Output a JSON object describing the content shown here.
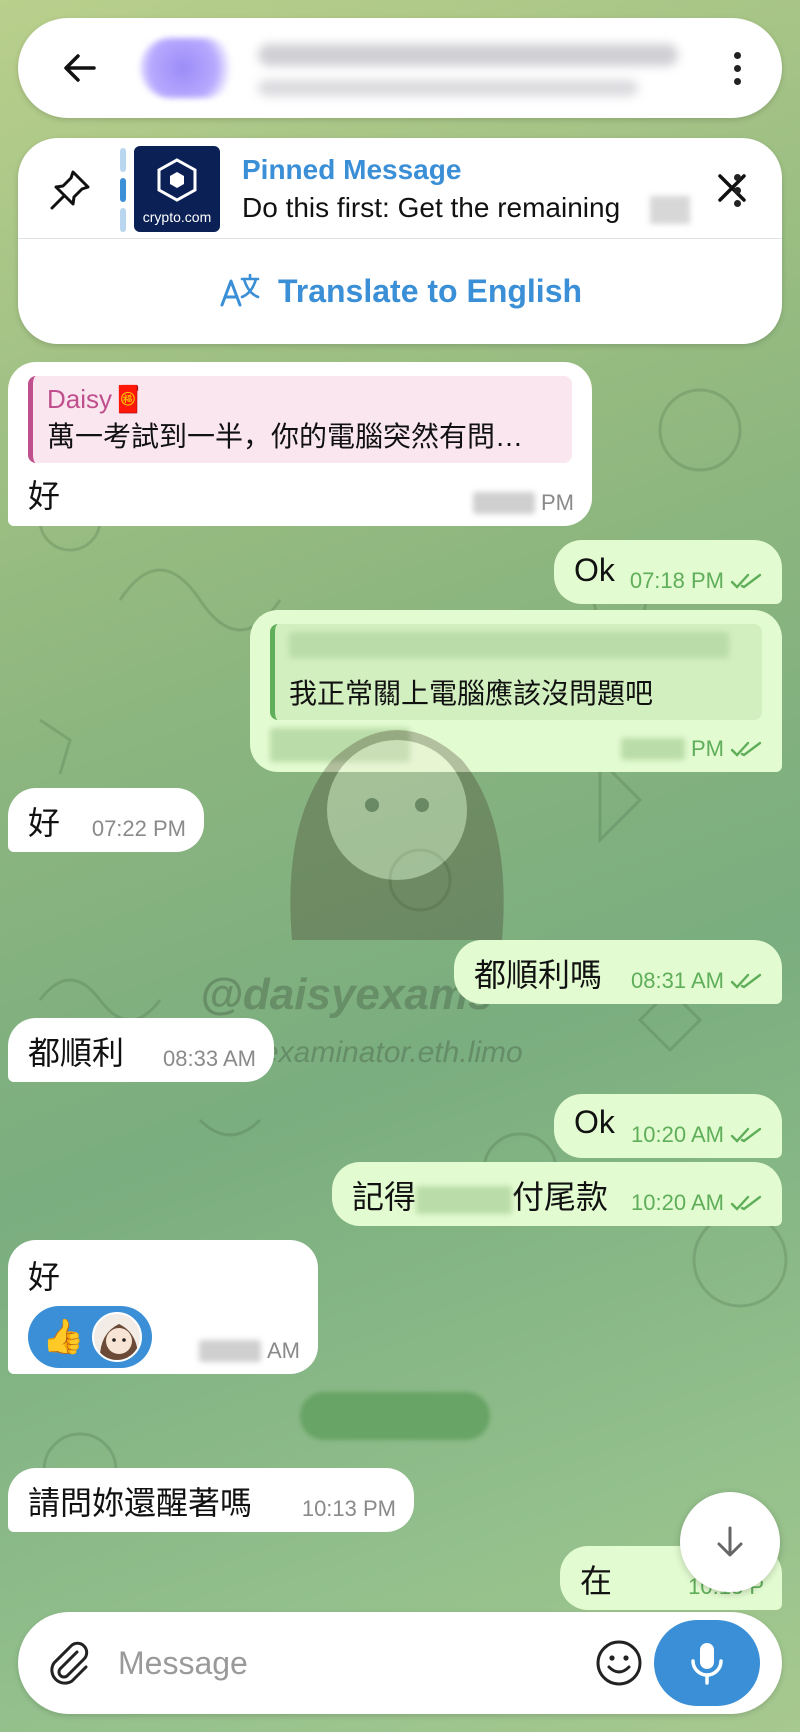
{
  "header": {
    "back_icon": "arrow-left-icon",
    "menu_icon": "more-vertical-icon"
  },
  "pinned": {
    "title": "Pinned Message",
    "text": "Do this first: Get the remaining",
    "logo_text": "crypto.com",
    "translate_label": "Translate to English"
  },
  "messages": {
    "m1": {
      "reply_name": "Daisy🧧",
      "reply_text": "萬一考試到一半，你的電腦突然有問…",
      "text": "好",
      "time": "PM"
    },
    "m2": {
      "text": "Ok",
      "time": "07:18 PM"
    },
    "m3": {
      "reply_text": "我正常關上電腦應該沒問題吧",
      "time": "PM"
    },
    "m4": {
      "text": "好",
      "time": "07:22 PM"
    },
    "m5": {
      "text": "都順利嗎",
      "time": "08:31 AM"
    },
    "m6": {
      "text": "都順利",
      "time": "08:33 AM"
    },
    "m7": {
      "text": "Ok",
      "time": "10:20 AM"
    },
    "m8": {
      "text_a": "記得",
      "text_b": "付尾款",
      "time": "10:20 AM"
    },
    "m9": {
      "text": "好",
      "reaction": "👍",
      "time": "AM"
    },
    "m10": {
      "text": "請問妳還醒著嗎",
      "time": "10:13 PM"
    },
    "m11": {
      "text": "在",
      "time": "10:13 P"
    }
  },
  "watermark": {
    "handle": "@daisyexams",
    "site": "examinator.eth.limo"
  },
  "input": {
    "placeholder": "Message"
  },
  "colors": {
    "accent": "#3a8fd6",
    "outgoing": "#e3fbd1",
    "reply_name": "#c0508d"
  }
}
